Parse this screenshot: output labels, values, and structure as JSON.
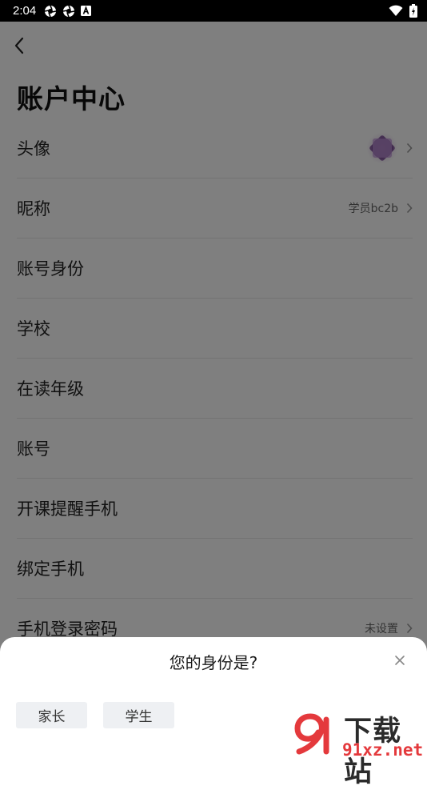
{
  "status_bar": {
    "time": "2:04",
    "icons": [
      "aperture-icon",
      "aperture-icon",
      "a-box-icon"
    ],
    "right_icons": [
      "wifi-icon",
      "battery-icon"
    ]
  },
  "header": {
    "back_icon": "chevron-left-icon",
    "title": "账户中心"
  },
  "rows": [
    {
      "label": "头像",
      "value": "",
      "has_avatar": true
    },
    {
      "label": "昵称",
      "value": "学员bc2b"
    },
    {
      "label": "账号身份",
      "value": ""
    },
    {
      "label": "学校",
      "value": ""
    },
    {
      "label": "在读年级",
      "value": ""
    },
    {
      "label": "账号",
      "value": ""
    },
    {
      "label": "开课提醒手机",
      "value": ""
    },
    {
      "label": "绑定手机",
      "value": ""
    },
    {
      "label": "手机登录密码",
      "value": "未设置"
    }
  ],
  "sheet": {
    "title": "您的身份是?",
    "options": [
      "家长",
      "学生"
    ],
    "close_icon": "close-icon"
  },
  "watermark": {
    "text": "下载站",
    "url": "91xz.net"
  },
  "colors": {
    "overlay": "rgba(0,0,0,0.5)",
    "option_bg": "#eef0f3",
    "watermark_red": "#e4393c"
  }
}
